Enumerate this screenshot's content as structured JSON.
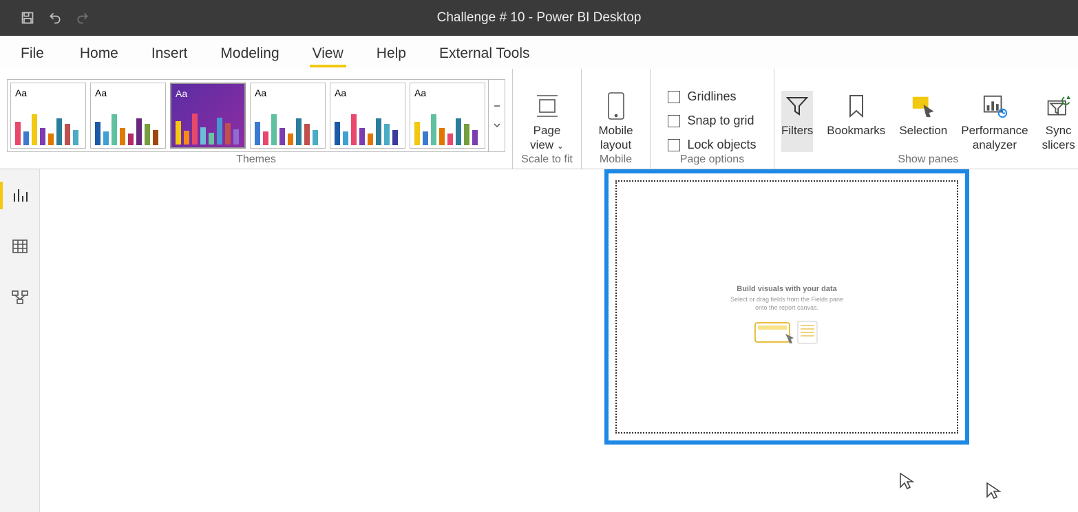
{
  "title": "Challenge # 10 - Power BI Desktop",
  "tabs": {
    "file": "File",
    "home": "Home",
    "insert": "Insert",
    "modeling": "Modeling",
    "view": "View",
    "help": "Help",
    "external": "External Tools"
  },
  "groups": {
    "themes_label": "Themes",
    "scale_label": "Scale to fit",
    "mobile_label": "Mobile",
    "pageopts_label": "Page options",
    "showpanes_label": "Show panes"
  },
  "pageview": {
    "line1": "Page",
    "line2": "view"
  },
  "mobile": {
    "line1": "Mobile",
    "line2": "layout"
  },
  "options": {
    "gridlines": "Gridlines",
    "snap": "Snap to grid",
    "lock": "Lock objects"
  },
  "panes": {
    "filters": "Filters",
    "bookmarks": "Bookmarks",
    "selection": "Selection",
    "perf1": "Performance",
    "perf2": "analyzer",
    "sync1": "Sync",
    "sync2": "slicers"
  },
  "placeholder": {
    "title": "Build visuals with your data",
    "sub1": "Select or drag fields from the Fields pane",
    "sub2": "onto the report canvas."
  },
  "theme_swatch_label": "Aa"
}
